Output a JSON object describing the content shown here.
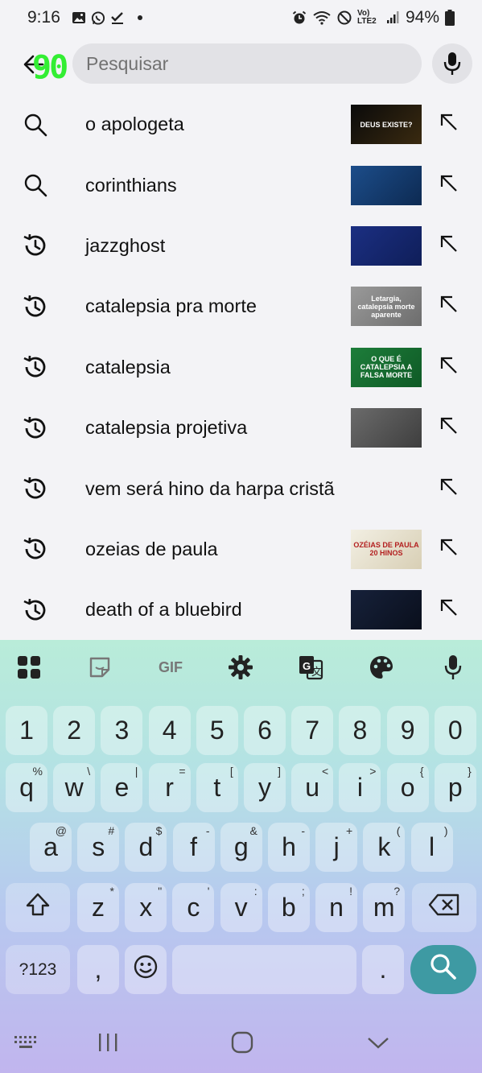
{
  "status_bar": {
    "time": "9:16",
    "battery": "94%",
    "network": "Vo) LTE2"
  },
  "search": {
    "placeholder": "Pesquisar",
    "value": "",
    "overlay_counter": "90"
  },
  "suggestions": [
    {
      "type": "search",
      "label": "o apologeta",
      "thumb_text": "DEUS EXISTE?",
      "thumb_colors": [
        "#0a0a0a",
        "#3a2a10"
      ]
    },
    {
      "type": "search",
      "label": "corinthians",
      "thumb_text": "",
      "thumb_colors": [
        "#1c4d8a",
        "#0d2a52"
      ]
    },
    {
      "type": "history",
      "label": "jazzghost",
      "thumb_text": "",
      "thumb_colors": [
        "#1b2f82",
        "#0f1e59"
      ]
    },
    {
      "type": "history",
      "label": "catalepsia pra morte",
      "thumb_text": "Letargia, catalepsia morte aparente",
      "thumb_colors": [
        "#9a9a9a",
        "#6d6d6d"
      ]
    },
    {
      "type": "history",
      "label": "catalepsia",
      "thumb_text": "O QUE É CATALEPSIA A FALSA MORTE",
      "thumb_colors": [
        "#1d7d3a",
        "#0f5a26"
      ]
    },
    {
      "type": "history",
      "label": "catalepsia projetiva",
      "thumb_text": "",
      "thumb_colors": [
        "#6b6b6b",
        "#3e3e3e"
      ]
    },
    {
      "type": "history",
      "label": "vem será hino da harpa cristã",
      "thumb_text": "",
      "thumb_colors": []
    },
    {
      "type": "history",
      "label": "ozeias de paula",
      "thumb_text": "OZÉIAS DE PAULA 20 HINOS",
      "thumb_colors": [
        "#f2efe3",
        "#d8cfb5"
      ]
    },
    {
      "type": "history",
      "label": "death of a bluebird",
      "thumb_text": "",
      "thumb_colors": [
        "#16213a",
        "#0a0f1c"
      ]
    }
  ],
  "keyboard": {
    "toolbar": [
      "apps-grid-icon",
      "sticker-icon",
      "GIF",
      "settings-icon",
      "translate-icon",
      "palette-icon",
      "mic-icon"
    ],
    "number_row": [
      "1",
      "2",
      "3",
      "4",
      "5",
      "6",
      "7",
      "8",
      "9",
      "0"
    ],
    "row1": [
      {
        "k": "q",
        "h": "%"
      },
      {
        "k": "w",
        "h": "\\"
      },
      {
        "k": "e",
        "h": "|"
      },
      {
        "k": "r",
        "h": "="
      },
      {
        "k": "t",
        "h": "["
      },
      {
        "k": "y",
        "h": "]"
      },
      {
        "k": "u",
        "h": "<"
      },
      {
        "k": "i",
        "h": ">"
      },
      {
        "k": "o",
        "h": "{"
      },
      {
        "k": "p",
        "h": "}"
      }
    ],
    "row2": [
      {
        "k": "a",
        "h": "@"
      },
      {
        "k": "s",
        "h": "#"
      },
      {
        "k": "d",
        "h": "$"
      },
      {
        "k": "f",
        "h": "-"
      },
      {
        "k": "g",
        "h": "&"
      },
      {
        "k": "h",
        "h": "-"
      },
      {
        "k": "j",
        "h": "+"
      },
      {
        "k": "k",
        "h": "("
      },
      {
        "k": "l",
        "h": ")"
      }
    ],
    "row3": [
      {
        "k": "z",
        "h": "*"
      },
      {
        "k": "x",
        "h": "\""
      },
      {
        "k": "c",
        "h": "'"
      },
      {
        "k": "v",
        "h": ":"
      },
      {
        "k": "b",
        "h": ";"
      },
      {
        "k": "n",
        "h": "!"
      },
      {
        "k": "m",
        "h": "?"
      }
    ],
    "sym_key": "?123",
    "comma": ",",
    "period": "."
  }
}
